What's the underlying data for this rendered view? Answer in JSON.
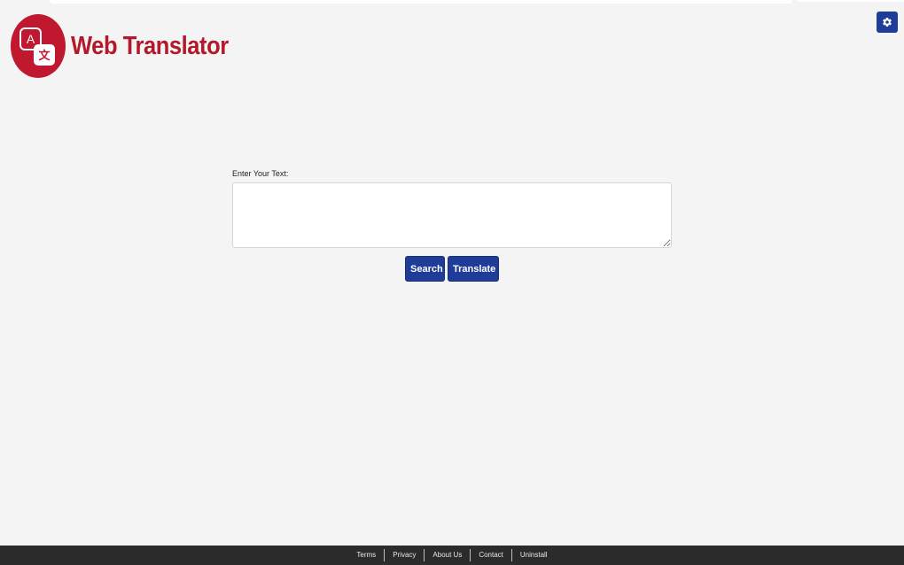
{
  "header": {
    "app_title": "Web Translator",
    "logo_icon": "translate-icon",
    "settings_icon": "gear-icon"
  },
  "form": {
    "label": "Enter Your Text:",
    "input_value": "",
    "input_placeholder": ""
  },
  "buttons": {
    "search_label": "Search",
    "translate_label": "Translate"
  },
  "footer": {
    "links": [
      "Terms",
      "Privacy",
      "About Us",
      "Contact",
      "Uninstall"
    ]
  },
  "colors": {
    "brand_red": "#c0182f",
    "button_blue": "#1f3c98",
    "footer_bg": "#2b2b2b",
    "page_bg": "#f4f4f4"
  }
}
